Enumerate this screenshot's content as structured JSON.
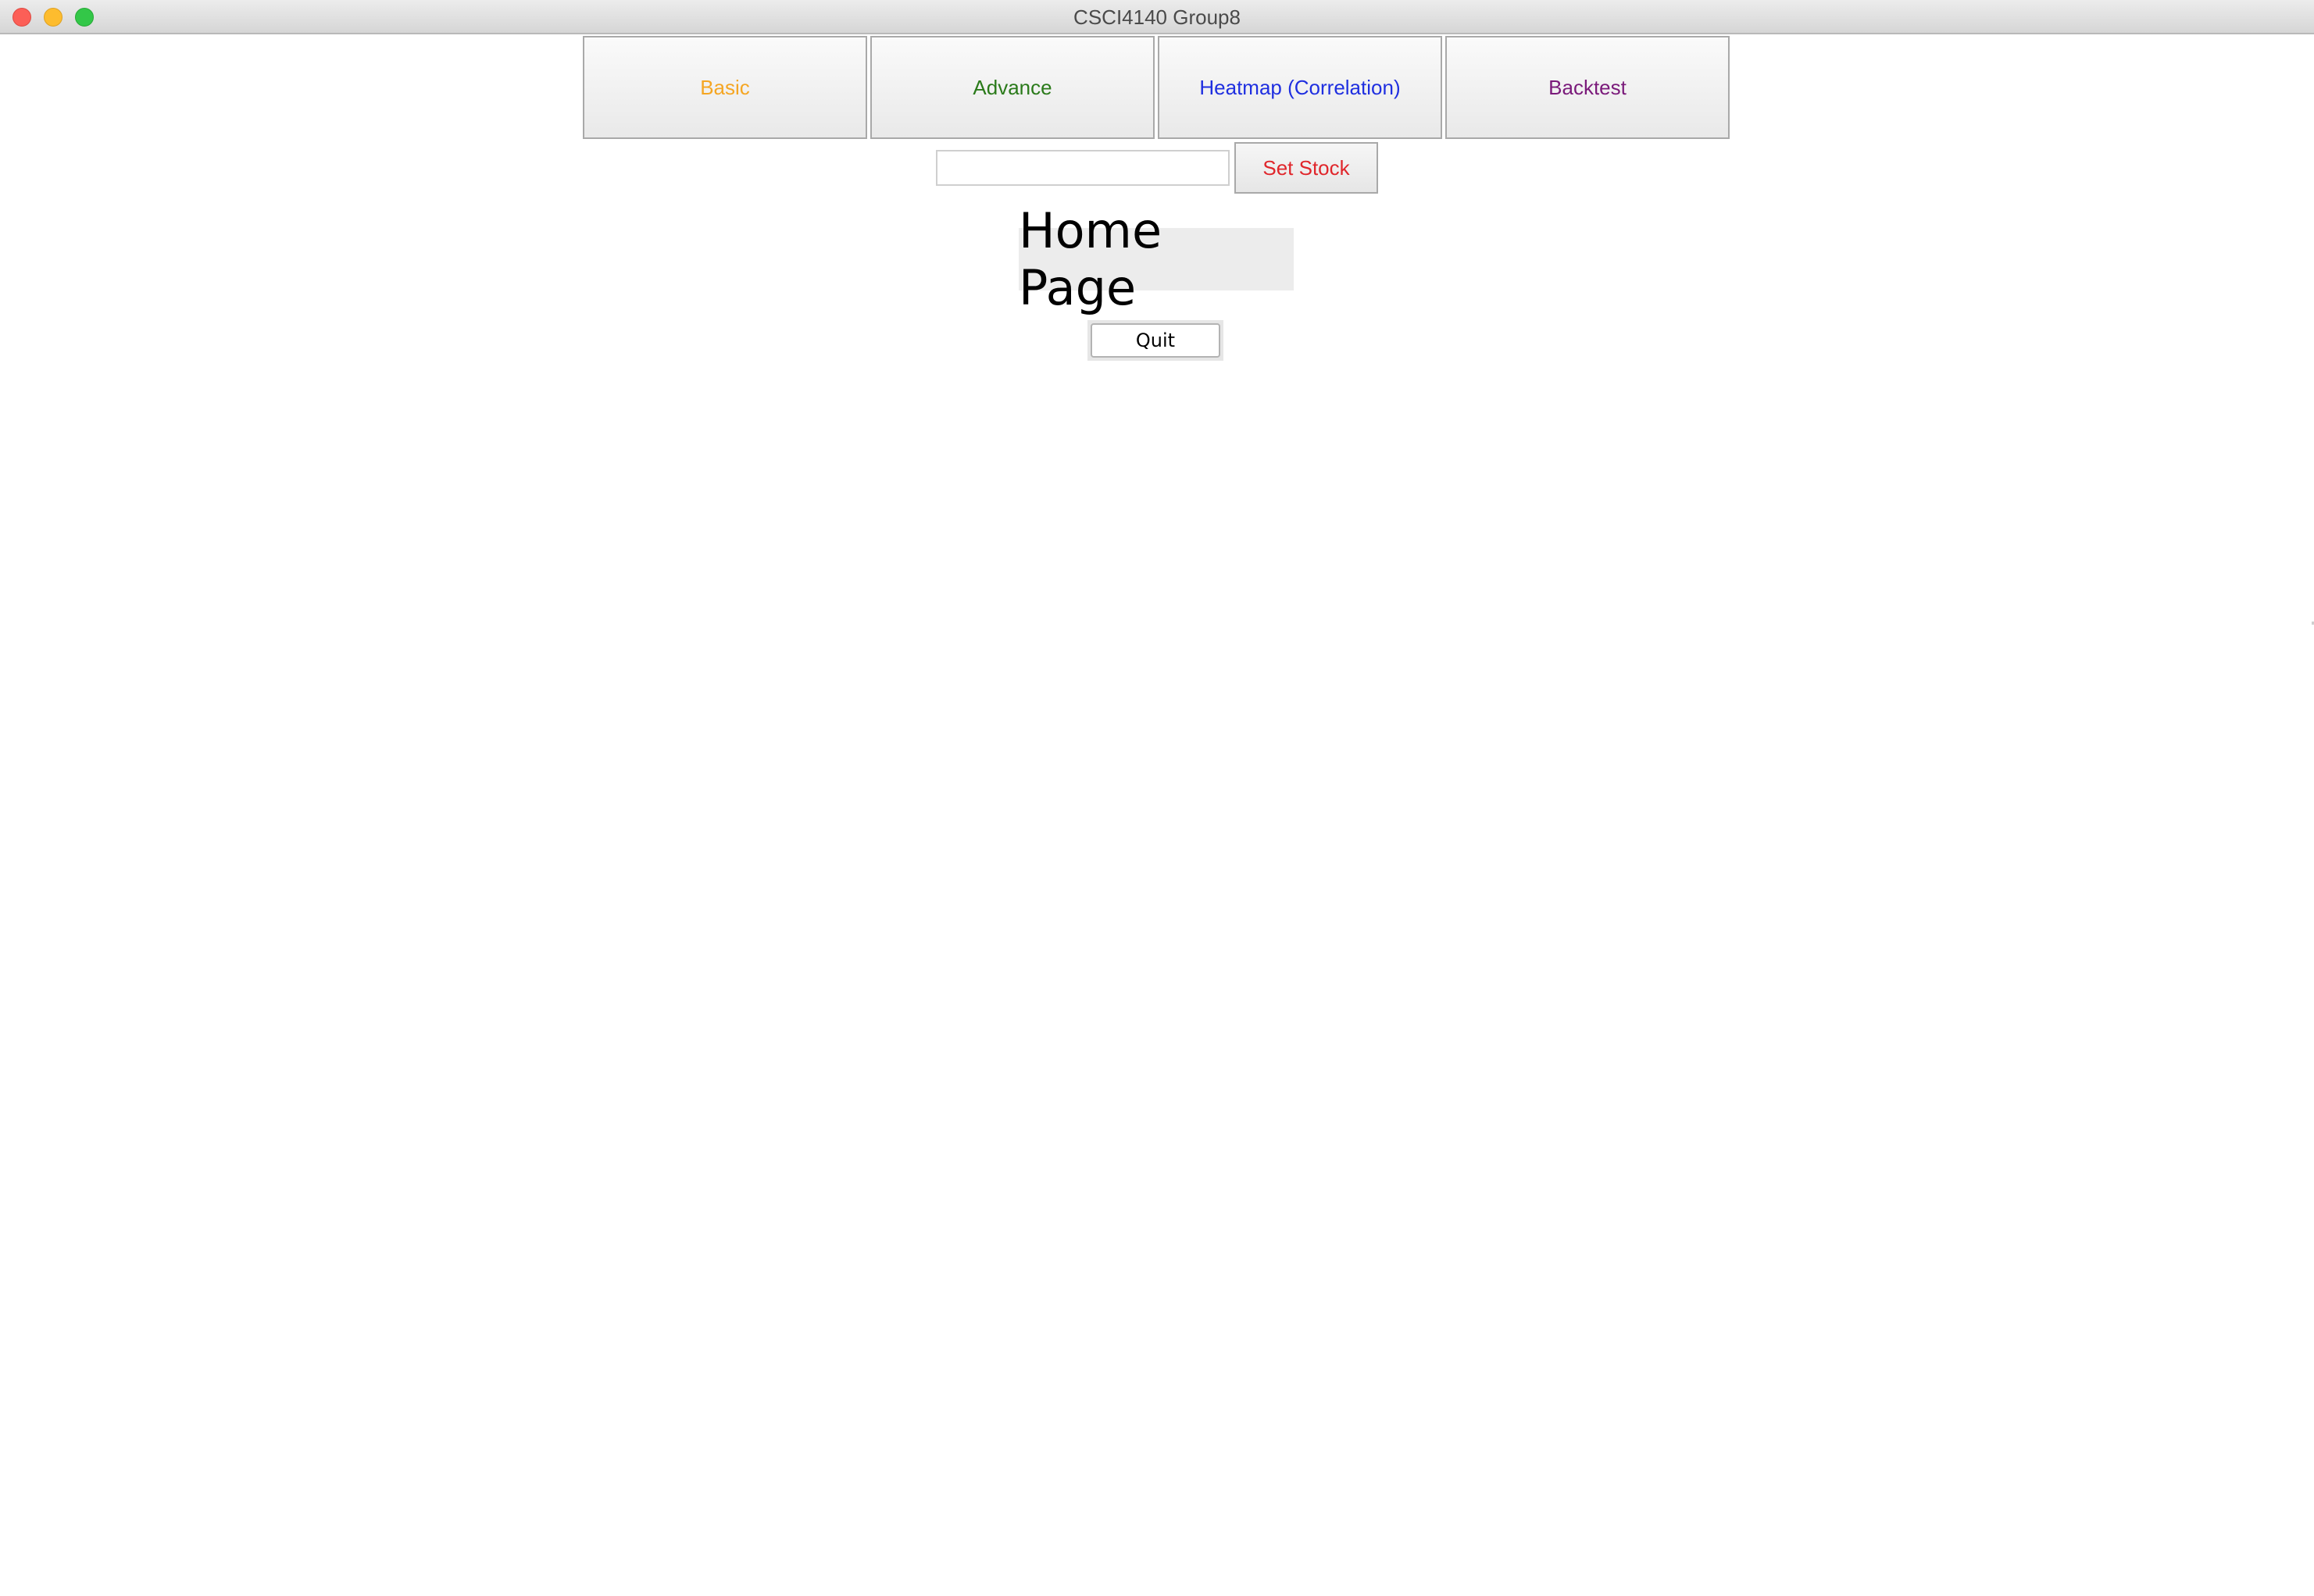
{
  "window": {
    "title": "CSCI4140 Group8"
  },
  "tabs": [
    {
      "label": "Basic",
      "color": "#f5a623"
    },
    {
      "label": "Advance",
      "color": "#2a7a1a"
    },
    {
      "label": "Heatmap (Correlation)",
      "color": "#1f2fe0"
    },
    {
      "label": "Backtest",
      "color": "#7a1a7a"
    }
  ],
  "stock": {
    "input_value": "",
    "button_label": "Set Stock",
    "button_color": "#e0262b"
  },
  "main": {
    "title": "Home Page",
    "quit_label": "Quit"
  }
}
